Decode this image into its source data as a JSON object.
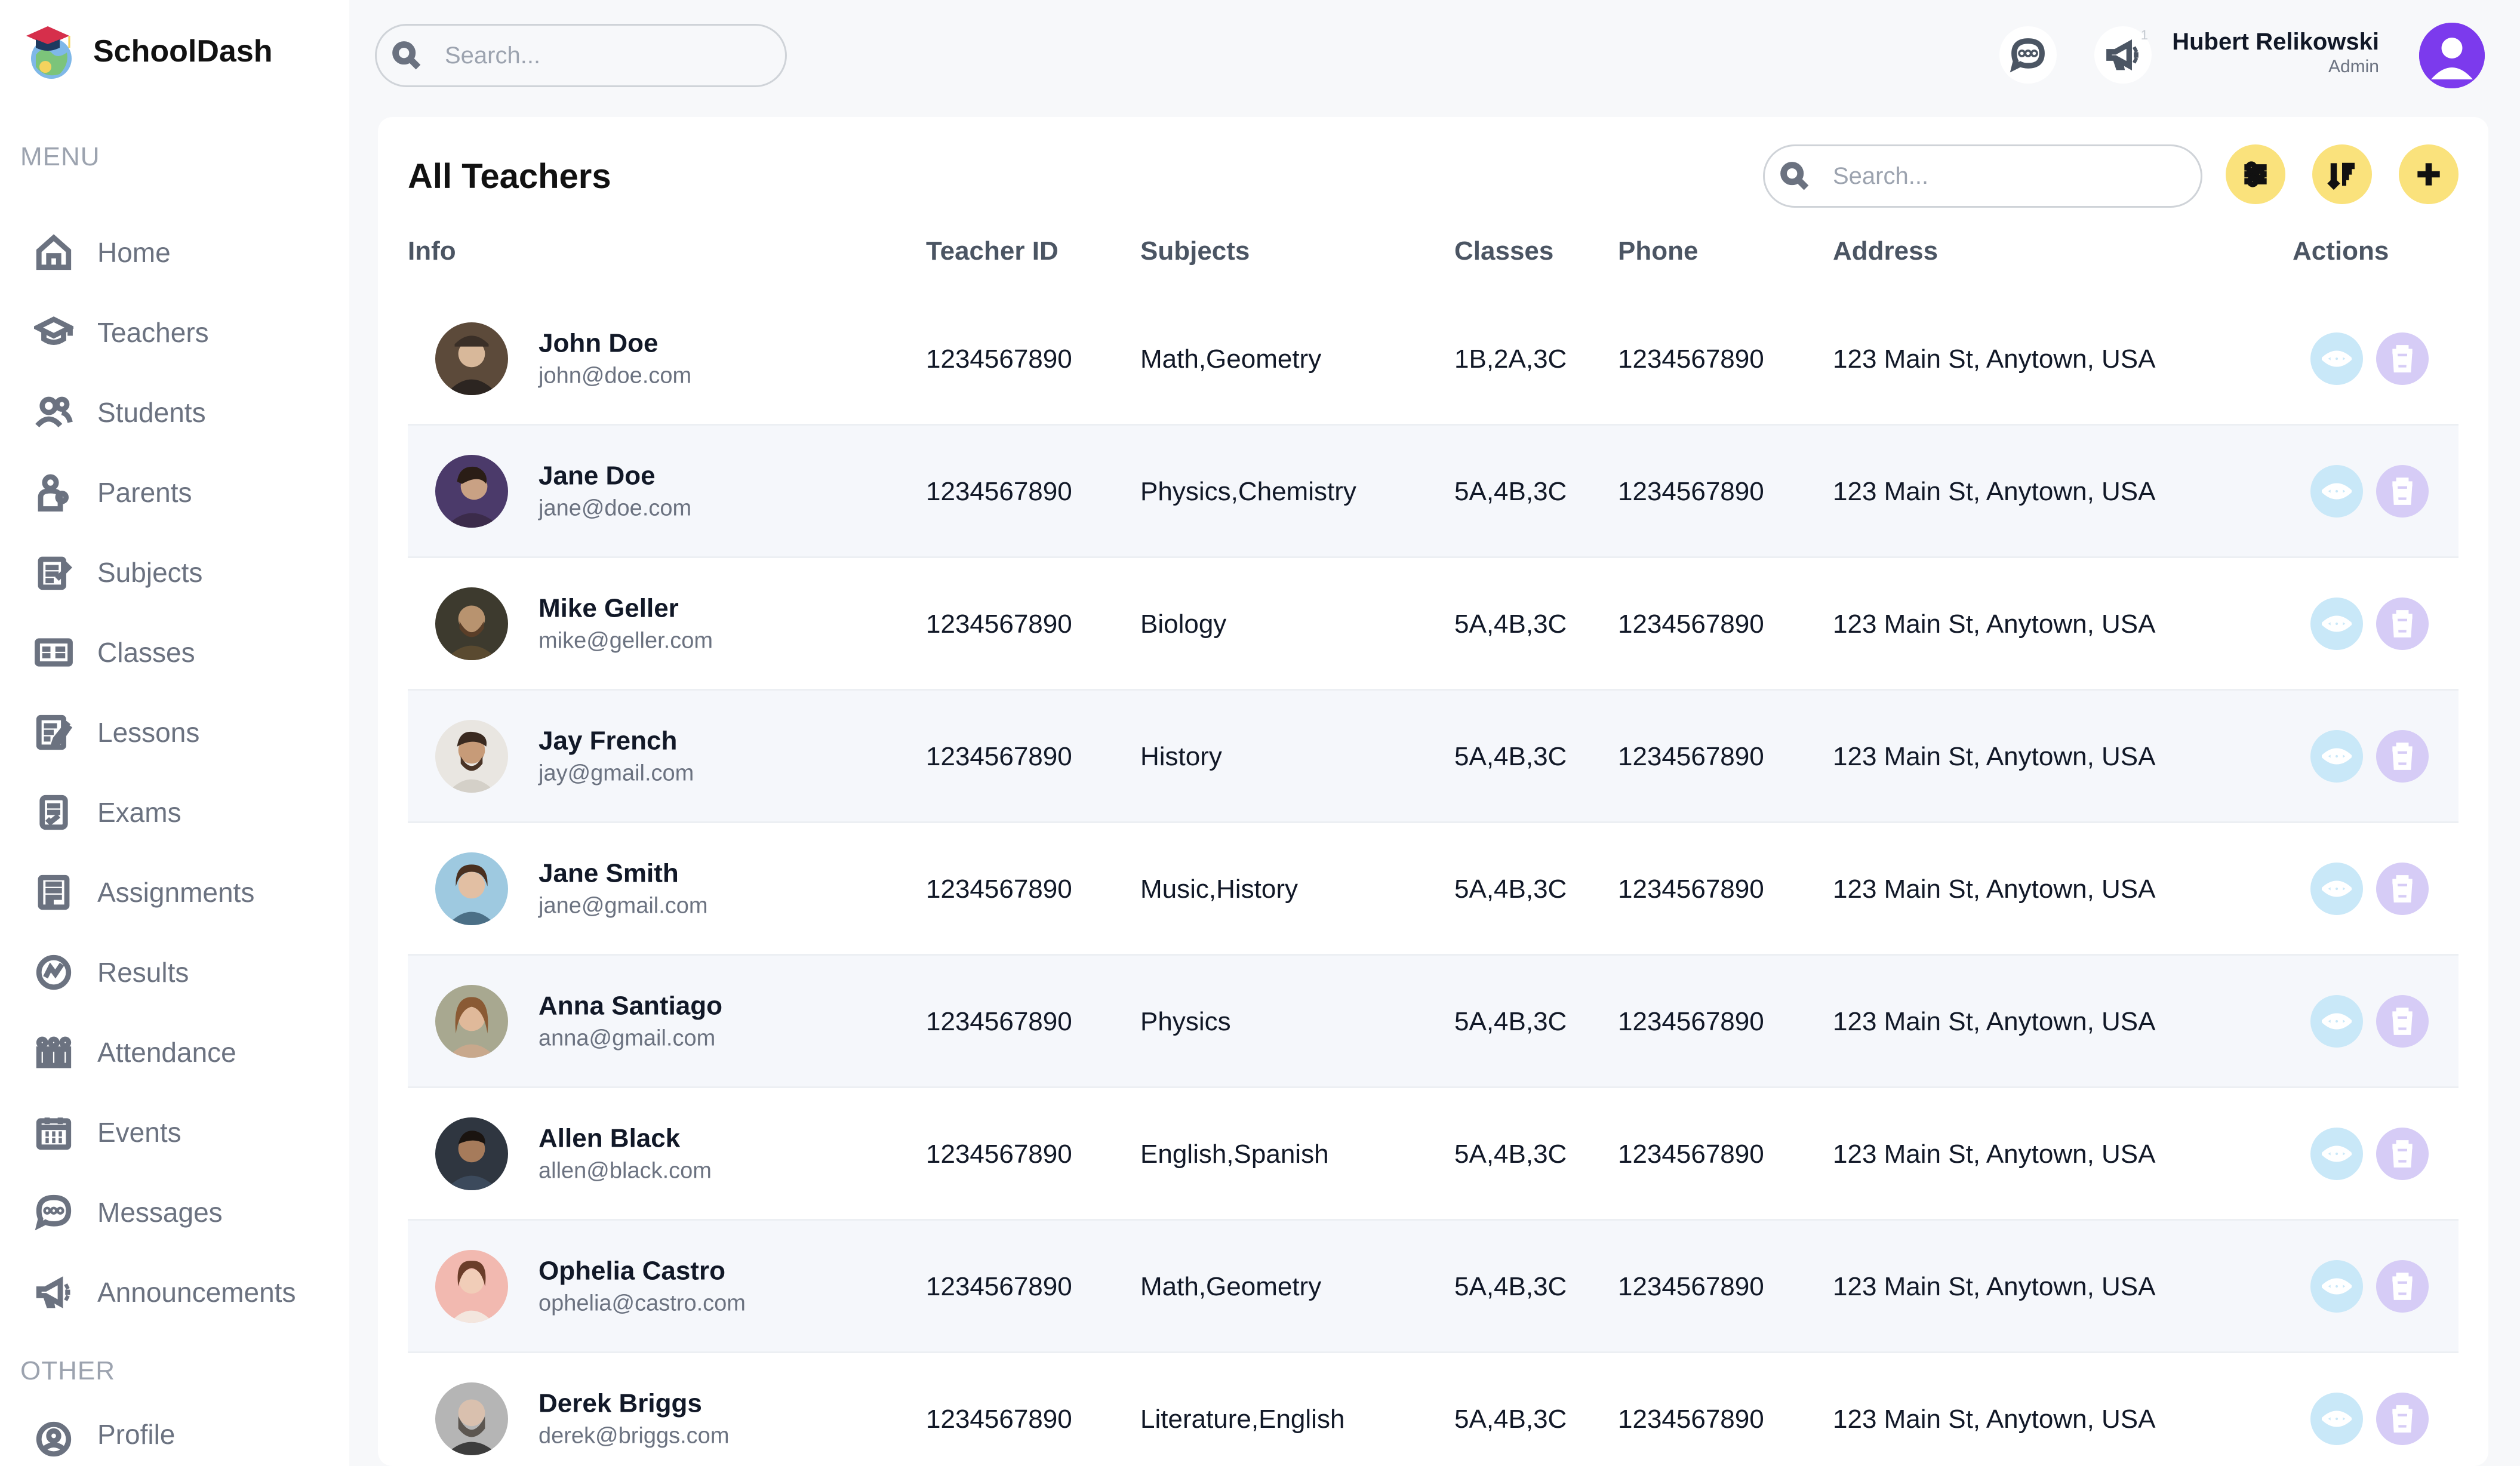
{
  "app": {
    "name": "SchoolDash"
  },
  "sidebar": {
    "menu_title": "MENU",
    "other_title": "OTHER",
    "items": [
      {
        "label": "Home",
        "icon": "home-icon"
      },
      {
        "label": "Teachers",
        "icon": "teacher-icon"
      },
      {
        "label": "Students",
        "icon": "students-icon"
      },
      {
        "label": "Parents",
        "icon": "parents-icon"
      },
      {
        "label": "Subjects",
        "icon": "subjects-icon"
      },
      {
        "label": "Classes",
        "icon": "classes-icon"
      },
      {
        "label": "Lessons",
        "icon": "lessons-icon"
      },
      {
        "label": "Exams",
        "icon": "exams-icon"
      },
      {
        "label": "Assignments",
        "icon": "assignments-icon"
      },
      {
        "label": "Results",
        "icon": "results-icon"
      },
      {
        "label": "Attendance",
        "icon": "attendance-icon"
      },
      {
        "label": "Events",
        "icon": "calendar-icon"
      },
      {
        "label": "Messages",
        "icon": "message-icon"
      },
      {
        "label": "Announcements",
        "icon": "megaphone-icon"
      }
    ],
    "other_items": [
      {
        "label": "Profile",
        "icon": "profile-icon"
      }
    ]
  },
  "topbar": {
    "search_placeholder": "Search...",
    "user_name": "Hubert Relikowski",
    "user_role": "Admin",
    "notification_count": "1"
  },
  "page": {
    "title": "All Teachers",
    "search_placeholder": "Search..."
  },
  "table": {
    "columns": {
      "info": "Info",
      "teacher_id": "Teacher ID",
      "subjects": "Subjects",
      "classes": "Classes",
      "phone": "Phone",
      "address": "Address",
      "actions": "Actions"
    },
    "rows": [
      {
        "name": "John Doe",
        "email": "john@doe.com",
        "id": "1234567890",
        "subjects": "Math,Geometry",
        "classes": "1B,2A,3C",
        "phone": "1234567890",
        "address": "123 Main St, Anytown, USA"
      },
      {
        "name": "Jane Doe",
        "email": "jane@doe.com",
        "id": "1234567890",
        "subjects": "Physics,Chemistry",
        "classes": "5A,4B,3C",
        "phone": "1234567890",
        "address": "123 Main St, Anytown, USA"
      },
      {
        "name": "Mike Geller",
        "email": "mike@geller.com",
        "id": "1234567890",
        "subjects": "Biology",
        "classes": "5A,4B,3C",
        "phone": "1234567890",
        "address": "123 Main St, Anytown, USA"
      },
      {
        "name": "Jay French",
        "email": "jay@gmail.com",
        "id": "1234567890",
        "subjects": "History",
        "classes": "5A,4B,3C",
        "phone": "1234567890",
        "address": "123 Main St, Anytown, USA"
      },
      {
        "name": "Jane Smith",
        "email": "jane@gmail.com",
        "id": "1234567890",
        "subjects": "Music,History",
        "classes": "5A,4B,3C",
        "phone": "1234567890",
        "address": "123 Main St, Anytown, USA"
      },
      {
        "name": "Anna Santiago",
        "email": "anna@gmail.com",
        "id": "1234567890",
        "subjects": "Physics",
        "classes": "5A,4B,3C",
        "phone": "1234567890",
        "address": "123 Main St, Anytown, USA"
      },
      {
        "name": "Allen Black",
        "email": "allen@black.com",
        "id": "1234567890",
        "subjects": "English,Spanish",
        "classes": "5A,4B,3C",
        "phone": "1234567890",
        "address": "123 Main St, Anytown, USA"
      },
      {
        "name": "Ophelia Castro",
        "email": "ophelia@castro.com",
        "id": "1234567890",
        "subjects": "Math,Geometry",
        "classes": "5A,4B,3C",
        "phone": "1234567890",
        "address": "123 Main St, Anytown, USA"
      },
      {
        "name": "Derek Briggs",
        "email": "derek@briggs.com",
        "id": "1234567890",
        "subjects": "Literature,English",
        "classes": "5A,4B,3C",
        "phone": "1234567890",
        "address": "123 Main St, Anytown, USA"
      }
    ]
  },
  "colors": {
    "accent_yellow": "#fae27c",
    "view_button": "#c9e8f8",
    "delete_button": "#d6ccf6",
    "row_alt": "#f5f7fb",
    "avatar_purple": "#7c3aed"
  }
}
